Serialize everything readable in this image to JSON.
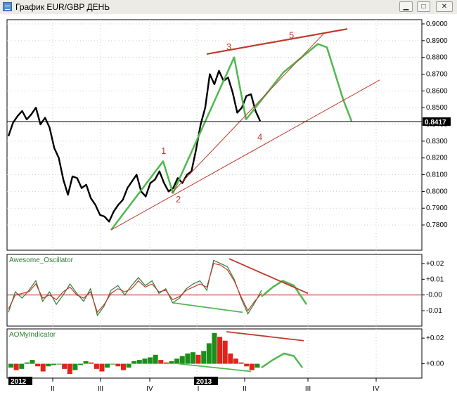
{
  "window": {
    "title": "График EUR/GBP ДЕНЬ",
    "min_icon": "minimize-icon",
    "max_icon": "maximize-icon",
    "close_icon": "close-icon"
  },
  "colors": {
    "price": "#000000",
    "wave": "#4fb84f",
    "trendline": "#c0392b",
    "oscillator_up": "#1a8f1a",
    "oscillator_down": "#e2231a",
    "osc_line_a": "#2e7d32",
    "osc_line_b": "#c0392b",
    "grid": "#cfcfcf"
  },
  "chart_data": [
    {
      "type": "line",
      "title": "",
      "ylabel": "",
      "ylim": [
        0.775,
        0.9
      ],
      "y_ticks": [
        "0.9000",
        "0.8900",
        "0.8800",
        "0.8700",
        "0.8600",
        "0.8500",
        "0.8400",
        "0.8300",
        "0.8200",
        "0.8100",
        "0.8000",
        "0.7900",
        "0.7800"
      ],
      "current_price": "0.8417",
      "wave_labels": [
        "1",
        "2",
        "3",
        "4",
        "5"
      ],
      "x_ticks": [
        "II",
        "III",
        "IV",
        "I",
        "II",
        "III",
        "IV"
      ],
      "year_labels": [
        "2012",
        "2013"
      ],
      "series": [
        {
          "values": [
            0.833,
            0.841,
            0.845,
            0.848,
            0.843,
            0.846,
            0.85,
            0.84,
            0.844,
            0.838,
            0.826,
            0.82,
            0.807,
            0.798,
            0.809,
            0.808,
            0.802,
            0.804,
            0.796,
            0.792,
            0.786,
            0.785,
            0.782,
            0.788,
            0.792,
            0.795,
            0.802,
            0.806,
            0.81,
            0.8,
            0.797,
            0.805,
            0.807,
            0.812,
            0.805,
            0.8,
            0.802,
            0.808,
            0.805,
            0.81,
            0.812,
            0.825,
            0.84,
            0.85,
            0.87,
            0.864,
            0.872,
            0.866,
            0.868,
            0.859,
            0.847,
            0.85,
            0.857,
            0.858,
            0.848,
            0.842
          ]
        }
      ],
      "wave_path_values": [
        0.777,
        0.818,
        0.799,
        0.88,
        0.843,
        0.871,
        0.888,
        0.886,
        0.855,
        0.842
      ]
    },
    {
      "type": "line",
      "title": "Awesome_Oscillator",
      "ylim": [
        -0.018,
        0.024
      ],
      "y_ticks": [
        "+0.02",
        "+0.01",
        "-0.00",
        "-0.01"
      ],
      "series": [
        {
          "values": [
            -0.011,
            0.002,
            -0.002,
            0.003,
            0.009,
            -0.004,
            0.002,
            -0.006,
            0.0,
            0.007,
            0.001,
            -0.004,
            0.004,
            -0.013,
            -0.007,
            0.003,
            0.006,
            0.0,
            0.006,
            0.011,
            0.006,
            0.009,
            0.001,
            0.004,
            -0.005,
            -0.002,
            0.004,
            0.007,
            0.009,
            0.003,
            0.022,
            0.02,
            0.018,
            0.01,
            -0.002,
            -0.012,
            -0.005,
            0.003
          ]
        },
        {
          "values": [
            -0.009,
            0.0,
            0.001,
            0.002,
            0.007,
            -0.002,
            0.0,
            -0.003,
            0.002,
            0.005,
            0.0,
            -0.002,
            0.002,
            -0.011,
            -0.006,
            0.001,
            0.004,
            0.002,
            0.004,
            0.009,
            0.005,
            0.007,
            0.002,
            0.003,
            -0.003,
            -0.001,
            0.003,
            0.005,
            0.007,
            0.005,
            0.02,
            0.019,
            0.016,
            0.009,
            -0.001,
            -0.01,
            -0.004,
            0.001
          ]
        }
      ],
      "forecast_values": [
        -0.001,
        0.005,
        0.009,
        0.006,
        -0.006
      ]
    },
    {
      "type": "bar",
      "title": "AOMyIndicator",
      "ylim": [
        -0.009,
        0.025
      ],
      "y_ticks": [
        "+0.02",
        "+0.00"
      ],
      "values": [
        -0.003,
        -0.005,
        -0.004,
        0.001,
        0.003,
        -0.002,
        -0.006,
        -0.002,
        -0.001,
        0.0,
        -0.004,
        -0.008,
        -0.005,
        -0.001,
        0.002,
        0.001,
        -0.004,
        -0.006,
        -0.003,
        0.0,
        -0.002,
        -0.005,
        -0.003,
        0.002,
        0.003,
        0.004,
        0.005,
        0.007,
        0.003,
        0.001,
        0.002,
        0.004,
        0.006,
        0.008,
        0.009,
        0.007,
        0.01,
        0.016,
        0.024,
        0.021,
        0.018,
        0.008,
        0.004,
        0.001,
        -0.002,
        -0.005,
        -0.003
      ],
      "forecast_values": [
        -0.003,
        0.003,
        0.008,
        0.006,
        -0.003
      ]
    }
  ]
}
